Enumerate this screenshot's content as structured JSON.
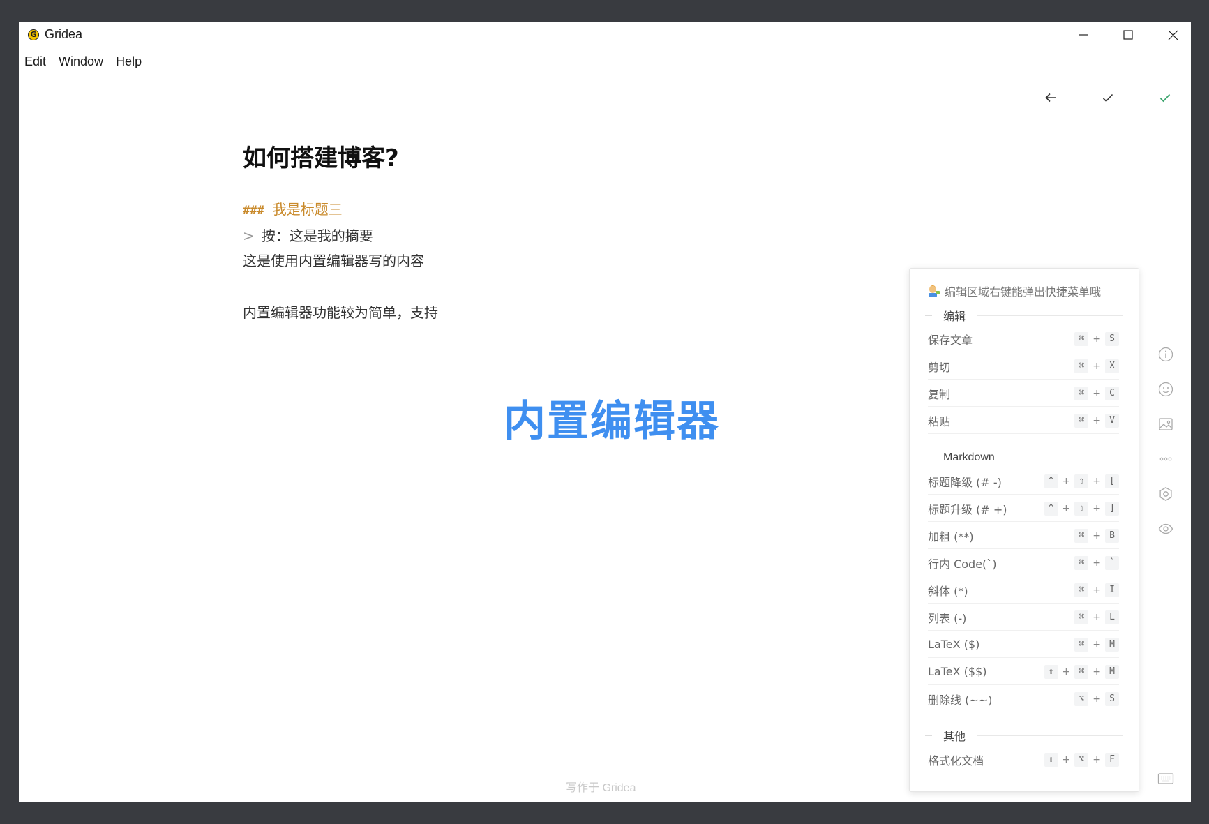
{
  "window": {
    "app_title": "Gridea",
    "menu": [
      "Edit",
      "Window",
      "Help"
    ]
  },
  "toolbar": {
    "back_icon": "arrow-left-icon",
    "save_draft_icon": "check-icon",
    "publish_icon": "check-green-icon",
    "accent": "#3ea66f"
  },
  "editor": {
    "title": "如何搭建博客?",
    "h3_mark": "###",
    "h3_text": "我是标题三",
    "quote_mark": ">",
    "quote_text": "按：这是我的摘要",
    "line1": "这是使用内置编辑器写的内容",
    "line2": "内置编辑器功能较为简单，支持"
  },
  "overlay_label": "内置编辑器",
  "footer": "写作于 Gridea",
  "shortcut_panel": {
    "tip": "编辑区域右键能弹出快捷菜单哦",
    "sections": [
      {
        "title": "编辑",
        "items": [
          {
            "name": "保存文章",
            "keys": [
              "⌘",
              "S"
            ]
          },
          {
            "name": "剪切",
            "keys": [
              "⌘",
              "X"
            ]
          },
          {
            "name": "复制",
            "keys": [
              "⌘",
              "C"
            ]
          },
          {
            "name": "粘贴",
            "keys": [
              "⌘",
              "V"
            ]
          }
        ]
      },
      {
        "title": "Markdown",
        "items": [
          {
            "name": "标题降级 (# -)",
            "keys": [
              "^",
              "⇧",
              "["
            ]
          },
          {
            "name": "标题升级 (# +)",
            "keys": [
              "^",
              "⇧",
              "]"
            ]
          },
          {
            "name": "加粗 (**)",
            "keys": [
              "⌘",
              "B"
            ]
          },
          {
            "name": "行内 Code(`)",
            "keys": [
              "⌘",
              "`"
            ]
          },
          {
            "name": "斜体 (*)",
            "keys": [
              "⌘",
              "I"
            ]
          },
          {
            "name": "列表 (-)",
            "keys": [
              "⌘",
              "L"
            ]
          },
          {
            "name": "LaTeX ($)",
            "keys": [
              "⌘",
              "M"
            ]
          },
          {
            "name": "LaTeX ($$)",
            "keys": [
              "⇧",
              "⌘",
              "M"
            ]
          },
          {
            "name": "删除线 (~~)",
            "keys": [
              "⌥",
              "S"
            ]
          }
        ]
      },
      {
        "title": "其他",
        "items": [
          {
            "name": "格式化文档",
            "keys": [
              "⇧",
              "⌥",
              "F"
            ]
          }
        ]
      }
    ]
  },
  "side_tools": [
    "info-icon",
    "emoji-icon",
    "image-icon",
    "more-icon",
    "settings-icon",
    "preview-icon",
    "keyboard-icon"
  ]
}
